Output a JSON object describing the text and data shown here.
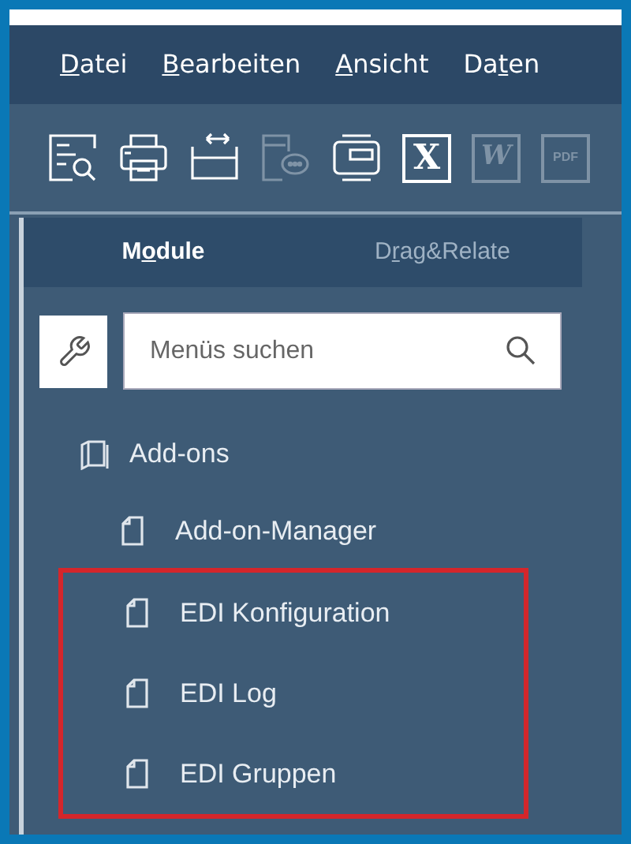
{
  "menu": [
    {
      "key": "D",
      "post": "atei"
    },
    {
      "key": "B",
      "post": "earbeiten"
    },
    {
      "key": "A",
      "post": "nsicht"
    },
    {
      "pre": "Da",
      "key": "t",
      "post": "en"
    }
  ],
  "toolbar": [
    {
      "kind": "preview",
      "disabled": false
    },
    {
      "kind": "print",
      "disabled": false
    },
    {
      "kind": "resize",
      "disabled": false
    },
    {
      "kind": "message",
      "disabled": true
    },
    {
      "kind": "window",
      "disabled": false
    },
    {
      "kind": "excel",
      "disabled": false,
      "text": "X"
    },
    {
      "kind": "word",
      "disabled": true,
      "text": "W"
    },
    {
      "kind": "pdf",
      "disabled": true,
      "text": "PDF"
    }
  ],
  "tabs": [
    {
      "pre": "M",
      "key": "o",
      "post": "dule",
      "selected": true
    },
    {
      "pre": "D",
      "key": "r",
      "post": "ag&Relate",
      "selected": false
    }
  ],
  "search": {
    "placeholder": "Menüs suchen"
  },
  "tree": [
    {
      "label": "Add-ons",
      "children": [
        {
          "label": "Add-on-Manager",
          "highlighted": false
        },
        {
          "label": "EDI Konfiguration",
          "highlighted": true
        },
        {
          "label": "EDI Log",
          "highlighted": true
        },
        {
          "label": "EDI Gruppen",
          "highlighted": true
        }
      ]
    }
  ]
}
